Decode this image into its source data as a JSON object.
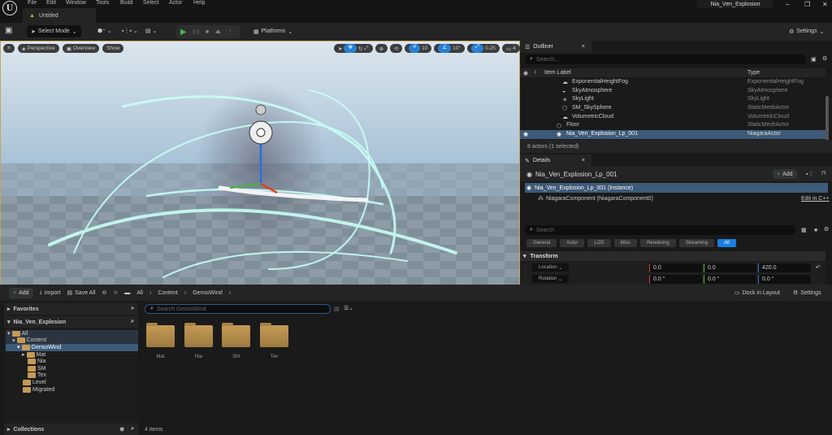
{
  "menu": [
    "File",
    "Edit",
    "Window",
    "Tools",
    "Build",
    "Select",
    "Actor",
    "Help"
  ],
  "doc_tab": "Untitled",
  "project_name": "Nia_Ven_Explosion",
  "toolbar": {
    "select_mode": "Select Mode",
    "platforms": "Platforms",
    "settings": "Settings"
  },
  "viewport": {
    "perspective": "Perspective",
    "overview": "Overview",
    "show": "Show",
    "grid_snap": "10",
    "rot_snap": "10°",
    "scale_snap": "0.25",
    "camera_speed": "4"
  },
  "outliner": {
    "tab": "Outliner",
    "search_placeholder": "Search...",
    "col_label": "Item Label",
    "col_type": "Type",
    "rows": [
      {
        "label": "ExponentialHeightFog",
        "type": "ExponentialHeightFog"
      },
      {
        "label": "SkyAtmosphere",
        "type": "SkyAtmosphere"
      },
      {
        "label": "SkyLight",
        "type": "SkyLight"
      },
      {
        "label": "SM_SkySphere",
        "type": "StaticMeshActor"
      },
      {
        "label": "VolumetricCloud",
        "type": "VolumetricCloud"
      },
      {
        "label": "Floor",
        "type": "StaticMeshActor"
      },
      {
        "label": "Nia_Ven_Explosion_Lp_001",
        "type": "NiagaraActor"
      }
    ],
    "status": "8 actors (1 selected)"
  },
  "details": {
    "tab": "Details",
    "title": "Nia_Ven_Explosion_Lp_001",
    "add": "Add",
    "instance": "Nia_Ven_Explosion_Lp_001 (Instance)",
    "component": "NiagaraComponent (NiagaraComponent0)",
    "edit_cpp": "Edit in C++",
    "search_placeholder": "Search",
    "filters": [
      "General",
      "Actor",
      "LOD",
      "Misc",
      "Rendering",
      "Streaming",
      "All"
    ],
    "section": "Transform",
    "location": {
      "label": "Location",
      "x": "0.0",
      "y": "0.0",
      "z": "420.0"
    },
    "rotation": {
      "label": "Rotation",
      "x": "0.0 °",
      "y": "0.0 °",
      "z": "0.0 °"
    }
  },
  "content_browser": {
    "add": "Add",
    "import": "Import",
    "save_all": "Save All",
    "breadcrumb": [
      "All",
      "Content",
      "GensoWind"
    ],
    "dock": "Dock in Layout",
    "settings": "Settings",
    "favorites": "Favorites",
    "project": "Nia_Ven_Explosion",
    "collections": "Collections",
    "tree": [
      "All",
      "Content",
      "GensoWind",
      "Mat",
      "Nia",
      "SM",
      "Tex",
      "Level",
      "Migrated"
    ],
    "search_placeholder": "Search GensoWind",
    "folders": [
      "Mat",
      "Nia",
      "SM",
      "Tex"
    ],
    "count": "4 items"
  },
  "colors": {
    "accent": "#2a7fd4",
    "selected": "#3d5a78",
    "folder": "#c49a55",
    "play": "#4caf50"
  }
}
